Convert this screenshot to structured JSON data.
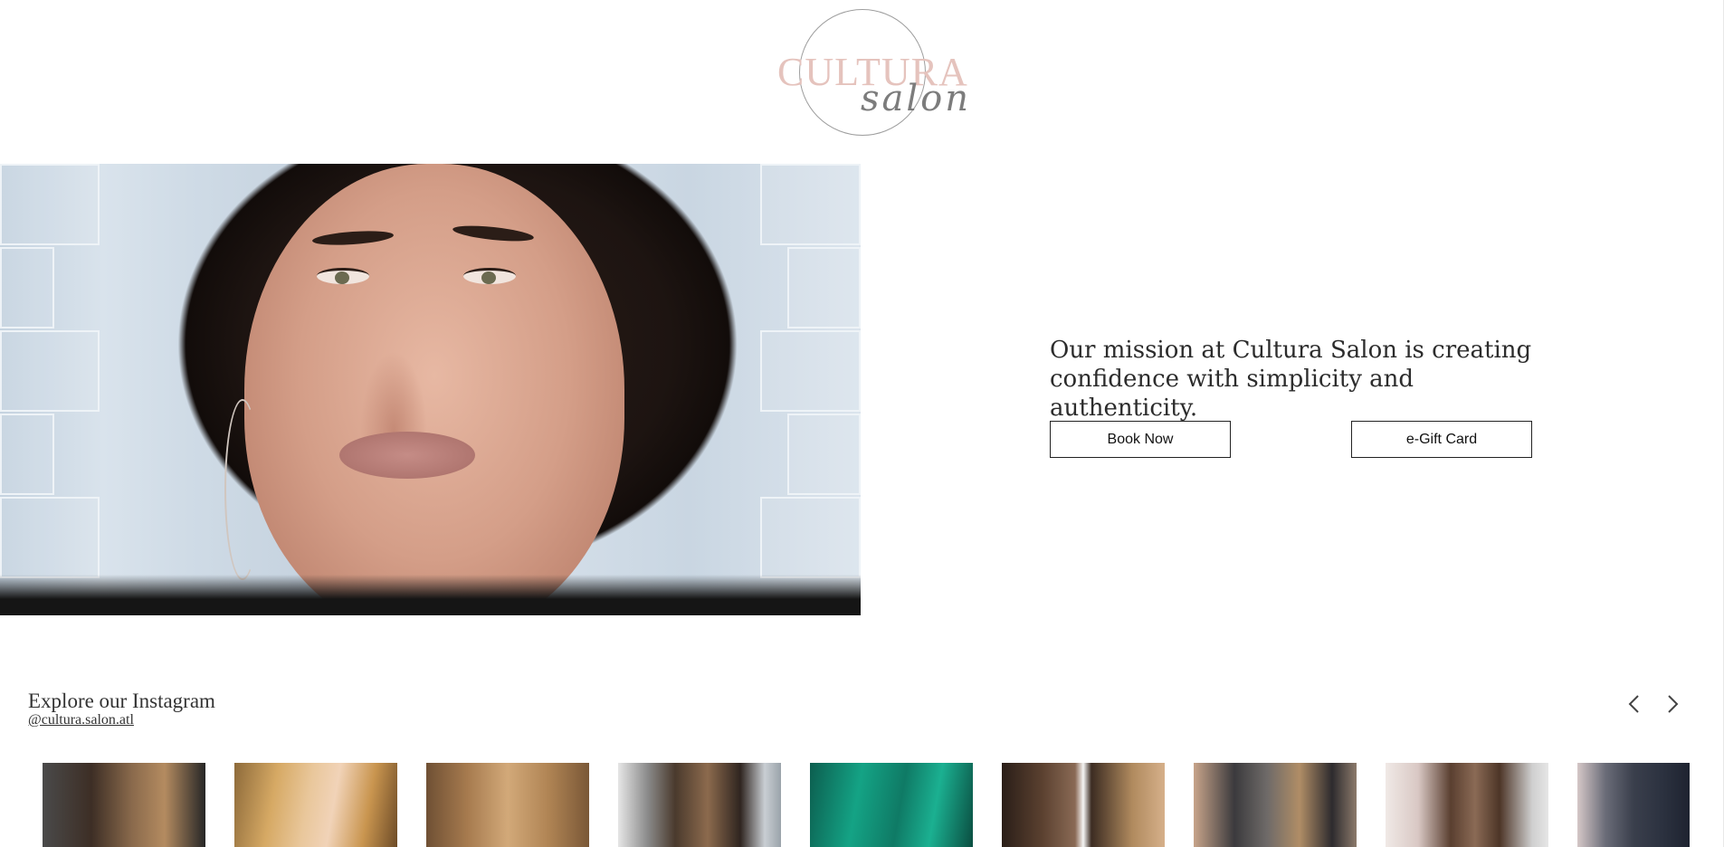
{
  "logo": {
    "main": "CULTURA",
    "script": "salon"
  },
  "hero": {
    "image_alt": "Portrait of woman with dark wavy hair"
  },
  "mission": {
    "text": "Our mission at Cultura Salon is creating confidence with simplicity and authenticity."
  },
  "buttons": {
    "book": "Book Now",
    "gift": "e-Gift Card"
  },
  "instagram": {
    "title": "Explore our Instagram",
    "handle": "@cultura.salon.atl",
    "prev_icon": "chevron-left-icon",
    "next_icon": "chevron-right-icon",
    "thumbnails": 9
  }
}
